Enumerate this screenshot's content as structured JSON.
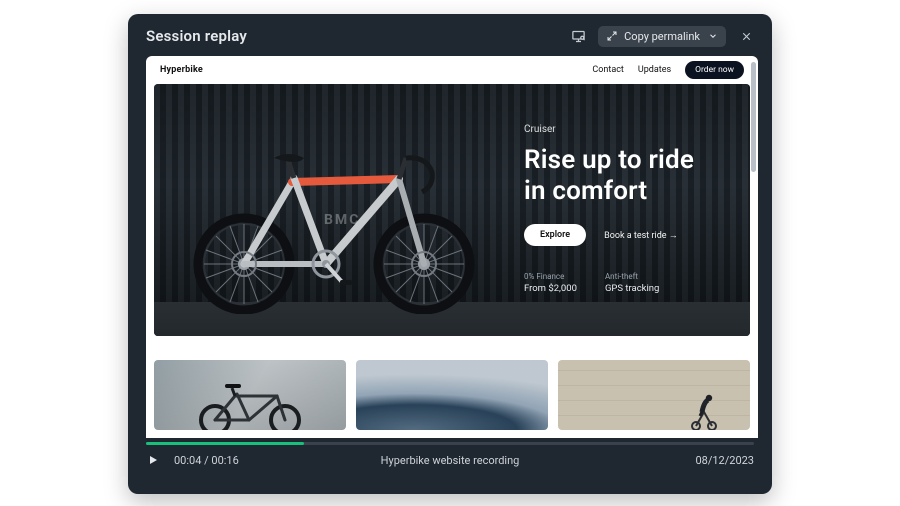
{
  "header": {
    "title": "Session replay",
    "copy_label": "Copy permalink"
  },
  "site": {
    "brand": "Hyperbike",
    "nav": {
      "contact": "Contact",
      "updates": "Updates",
      "order": "Order now"
    }
  },
  "hero": {
    "eyebrow": "Cruiser",
    "headline_line1": "Rise up to ride",
    "headline_line2": "in comfort",
    "cta_primary": "Explore",
    "cta_secondary": "Book a test ride →",
    "spec1_label": "0% Finance",
    "spec1_value": "From $2,000",
    "spec2_label": "Anti-theft",
    "spec2_value": "GPS tracking"
  },
  "player": {
    "current": "00:04",
    "sep": " / ",
    "total": "00:16",
    "title": "Hyperbike website recording",
    "date": "08/12/2023",
    "progress_percent": 26
  }
}
